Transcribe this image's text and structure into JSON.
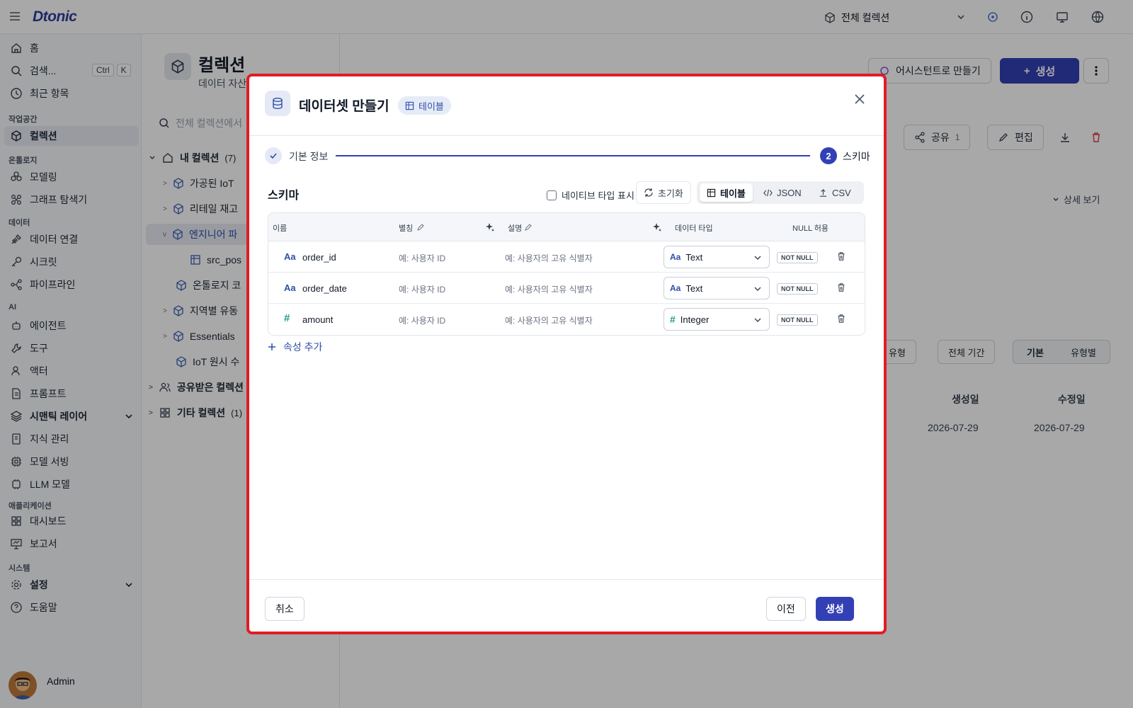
{
  "app": {
    "logo": "Dtonic"
  },
  "topbar": {
    "collection_select": "전체 컬렉션"
  },
  "sidebar": {
    "home": "홈",
    "search": "검색...",
    "search_kbd1": "Ctrl",
    "search_kbd2": "K",
    "recent": "최근 항목",
    "sections": {
      "workspace": "작업공간",
      "ontology": "온톨로지",
      "data": "데이터",
      "ai": "AI",
      "applications": "애플리케이션",
      "system": "시스템"
    },
    "items": {
      "collections": "컬렉션",
      "modeling": "모델링",
      "graph_explorer": "그래프 탐색기",
      "data_connection": "데이터 연결",
      "secrets": "시크릿",
      "pipeline": "파이프라인",
      "agent": "에이전트",
      "tools": "도구",
      "actors": "액터",
      "prompts": "프롬프트",
      "semantic_layer": "시맨틱 레이어",
      "knowledge": "지식 관리",
      "model_serving": "모델 서빙",
      "llm_models": "LLM 모델",
      "dashboard": "대시보드",
      "reports": "보고서",
      "settings": "설정",
      "help": "도움말"
    },
    "user": "Admin"
  },
  "panel": {
    "search_placeholder": "전체 컬렉션에서",
    "my_collections": "내 컬렉션",
    "my_count": "(7)",
    "tree": [
      "가공된 IoT",
      "리테일 재고",
      "엔지니어 파",
      "src_pos",
      "온톨로지 코",
      "지역별 유동",
      "Essentials",
      "IoT 원시 수"
    ],
    "shared": "공유받은 컬렉션",
    "other": "기타 컬렉션",
    "other_count": "(1)"
  },
  "main": {
    "title": "컬렉션",
    "subtitle": "데이터 자산",
    "assistant_btn": "어시스턴트로 만들기",
    "create_btn": "생성",
    "share_btn": "공유",
    "share_count": "1",
    "edit_btn": "편집",
    "detail_view": "상세 보기",
    "filter_type": "유형",
    "filter_period": "전체 기간",
    "view_basic": "기본",
    "view_by_type": "유형별",
    "col_created": "생성일",
    "col_modified": "수정일",
    "created_date": "2026-07-29",
    "modified_date": "2026-07-29"
  },
  "modal": {
    "title": "데이터셋 만들기",
    "badge": "테이블",
    "step1": "기본 정보",
    "step2_num": "2",
    "step2": "스키마",
    "schema_title": "스키마",
    "native_type_label": "네이티브 타입 표시",
    "reset": "초기화",
    "view_tabs": [
      "테이블",
      "JSON",
      "CSV"
    ],
    "columns": {
      "name": "이름",
      "alias": "별칭",
      "description": "설명",
      "data_type": "데이터 타입",
      "nullable": "NULL 허용"
    },
    "rows": [
      {
        "icon": "Aa",
        "name": "order_id",
        "alias_ph": "예: 사용자 ID",
        "desc_ph": "예: 사용자의 고유 식별자",
        "type": "Text",
        "null": "NOT NULL"
      },
      {
        "icon": "Aa",
        "name": "order_date",
        "alias_ph": "예: 사용자 ID",
        "desc_ph": "예: 사용자의 고유 식별자",
        "type": "Text",
        "null": "NOT NULL"
      },
      {
        "icon": "#",
        "name": "amount",
        "alias_ph": "예: 사용자 ID",
        "desc_ph": "예: 사용자의 고유 식별자",
        "type": "Integer",
        "null": "NOT NULL"
      }
    ],
    "add_attribute": "속성 추가",
    "cancel": "취소",
    "previous": "이전",
    "create": "생성"
  },
  "colors": {
    "primary": "#3340b5",
    "highlight_border": "#e31b23"
  }
}
